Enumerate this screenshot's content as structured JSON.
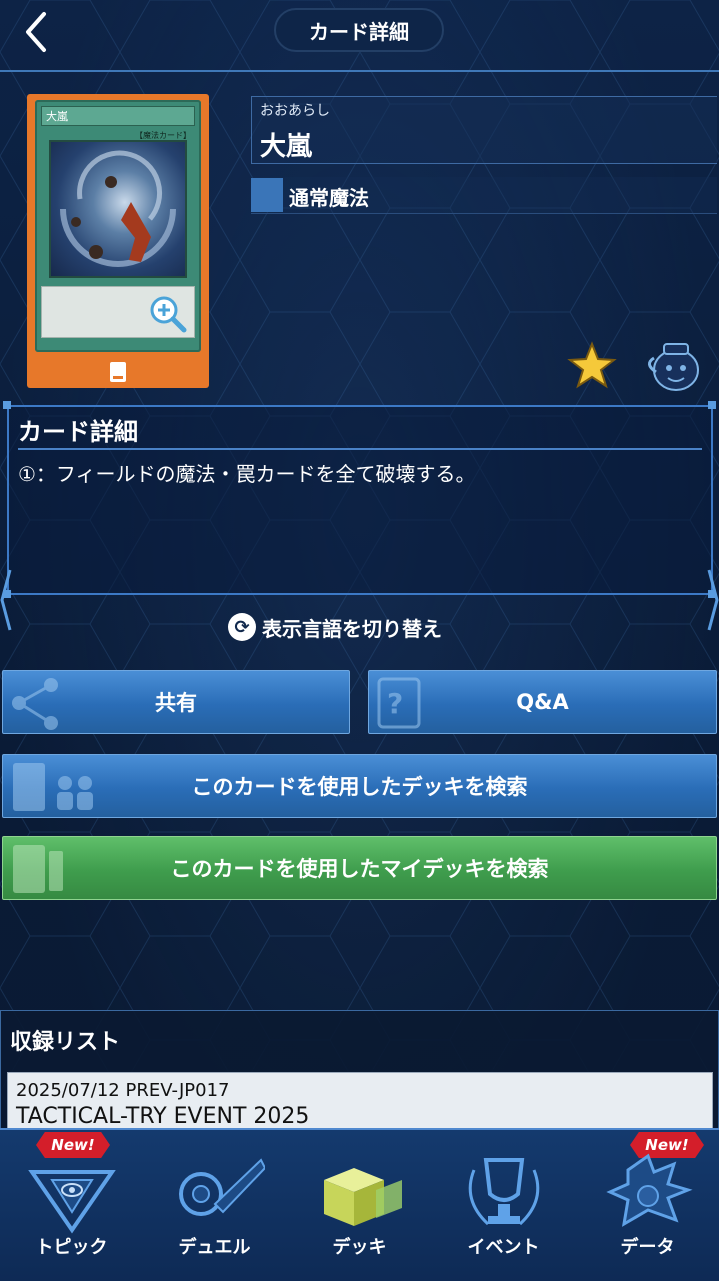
{
  "header": {
    "title": "カード詳細"
  },
  "card": {
    "ruby": "おおあらし",
    "name": "大嵐",
    "face_name": "大嵐",
    "face_type": "【魔法カード】",
    "type": "通常魔法"
  },
  "details": {
    "title": "カード詳細",
    "text": "①：フィールドの魔法・罠カードを全て破壊する。"
  },
  "lang_toggle": {
    "label": "表示言語を切り替え"
  },
  "buttons": {
    "share": "共有",
    "qa": "Q&A",
    "search_decks": "このカードを使用したデッキを検索",
    "search_my_decks": "このカードを使用したマイデッキを検索"
  },
  "list": {
    "title": "収録リスト",
    "items": [
      {
        "date": "2025/07/12 PREV-JP017",
        "name": "TACTICAL-TRY EVENT 2025"
      }
    ]
  },
  "nav": {
    "badge_new": "New!",
    "items": [
      {
        "label": "トピック"
      },
      {
        "label": "デュエル"
      },
      {
        "label": "デッキ"
      },
      {
        "label": "イベント"
      },
      {
        "label": "データ"
      }
    ]
  },
  "colors": {
    "accent_blue": "#2a6db7",
    "accent_green": "#3f9d4d",
    "card_frame_orange": "#e7782a",
    "new_badge_red": "#d41e2a"
  }
}
